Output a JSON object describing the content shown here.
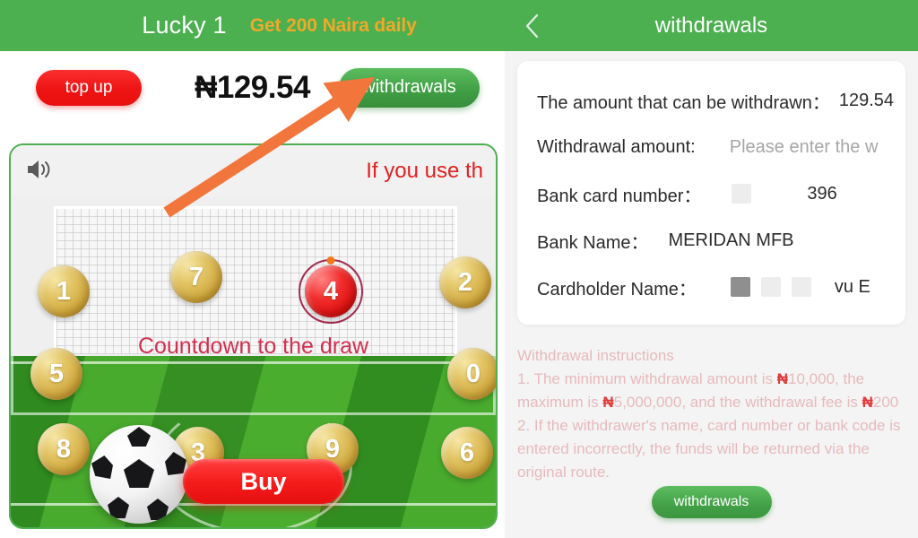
{
  "left": {
    "header": {
      "title": "Lucky 1",
      "promo": "Get 200 Naira daily"
    },
    "balance_bar": {
      "topup_label": "top up",
      "balance": "₦129.54",
      "withdrawals_label": "withdrawals"
    },
    "game": {
      "marquee_text": "If you use th",
      "countdown_text": "Countdown to the draw",
      "buy_label": "Buy",
      "balls": [
        {
          "number": "1",
          "selected": false
        },
        {
          "number": "7",
          "selected": false
        },
        {
          "number": "4",
          "selected": true
        },
        {
          "number": "2",
          "selected": false
        },
        {
          "number": "5",
          "selected": false
        },
        {
          "number": "0",
          "selected": false
        },
        {
          "number": "8",
          "selected": false
        },
        {
          "number": "3",
          "selected": false
        },
        {
          "number": "9",
          "selected": false
        },
        {
          "number": "6",
          "selected": false
        }
      ]
    }
  },
  "right": {
    "header": {
      "back_icon": "chevron-left-icon",
      "title": "withdrawals"
    },
    "form": {
      "available_label": "The amount that can be withdrawn：",
      "available_value": "129.54",
      "amount_label": "Withdrawal amount:",
      "amount_placeholder": "Please enter the w",
      "card_label": "Bank card number：",
      "card_value": "396",
      "bank_label": "Bank Name：",
      "bank_value": "MERIDAN MFB",
      "cardholder_label": "Cardholder Name：",
      "cardholder_value": "vu E"
    },
    "instructions": {
      "heading": "Withdrawal instructions",
      "line1_a": "1. The minimum withdrawal amount is ",
      "line1_n1": "₦",
      "line1_b": "10,000, the maximum is ",
      "line1_n2": "₦",
      "line1_c": "5,000,000, and the withdrawal fee is ",
      "line1_n3": "₦",
      "line1_d": "200",
      "line2": "2. If the withdrawer's name, card number or bank code is entered incorrectly, the funds will be returned via the original route."
    },
    "submit_label": "withdrawals"
  },
  "colors": {
    "header_green": "#4caf50",
    "promo_gold": "#f0a92a",
    "topup_red": "#ef1414",
    "buy_red": "#f51c1c",
    "instructions_pink": "#e7b9bc",
    "naira_red": "#e03a3a",
    "arrow_orange": "#f2763c"
  }
}
